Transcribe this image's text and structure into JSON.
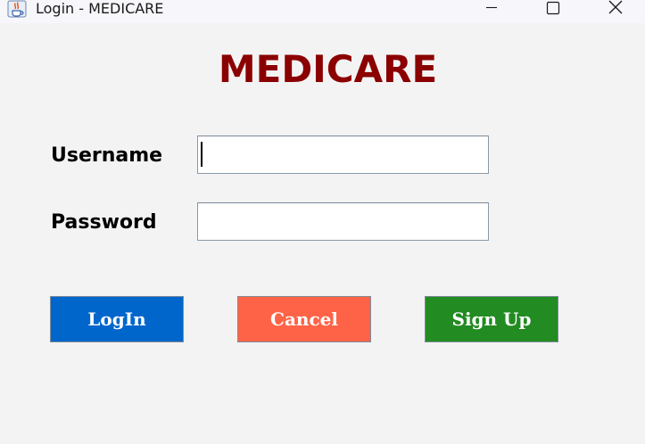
{
  "window": {
    "title": "Login - MEDICARE",
    "icon": "java-cup-icon",
    "controls": {
      "minimize": "minimize-icon",
      "maximize": "maximize-icon",
      "close": "close-icon"
    }
  },
  "header": {
    "title": "MEDICARE",
    "title_color": "#8b0000"
  },
  "form": {
    "username": {
      "label": "Username",
      "value": "",
      "placeholder": ""
    },
    "password": {
      "label": "Password",
      "value": "",
      "placeholder": ""
    }
  },
  "buttons": {
    "login": {
      "label": "LogIn",
      "color": "#0066cc"
    },
    "cancel": {
      "label": "Cancel",
      "color": "#ff6347"
    },
    "signup": {
      "label": "Sign Up",
      "color": "#228b22"
    }
  }
}
